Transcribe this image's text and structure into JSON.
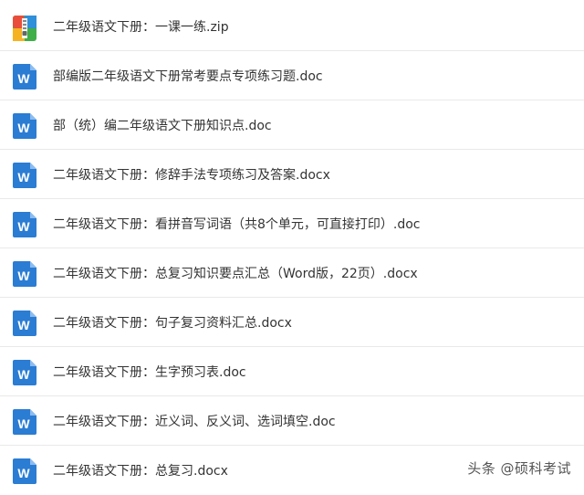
{
  "files": [
    {
      "name": "二年级语文下册：一课一练.zip",
      "icon": "zip-archive-icon"
    },
    {
      "name": "部编版二年级语文下册常考要点专项练习题.doc",
      "icon": "word-doc-icon"
    },
    {
      "name": "部（统）编二年级语文下册知识点.doc",
      "icon": "word-doc-icon"
    },
    {
      "name": "二年级语文下册：修辞手法专项练习及答案.docx",
      "icon": "word-doc-icon"
    },
    {
      "name": "二年级语文下册：看拼音写词语（共8个单元，可直接打印）.doc",
      "icon": "word-doc-icon"
    },
    {
      "name": "二年级语文下册：总复习知识要点汇总（Word版，22页）.docx",
      "icon": "word-doc-icon"
    },
    {
      "name": "二年级语文下册：句子复习资料汇总.docx",
      "icon": "word-doc-icon"
    },
    {
      "name": "二年级语文下册：生字预习表.doc",
      "icon": "word-doc-icon"
    },
    {
      "name": "二年级语文下册：近义词、反义词、选词填空.doc",
      "icon": "word-doc-icon"
    },
    {
      "name": "二年级语文下册：总复习.docx",
      "icon": "word-doc-icon"
    }
  ],
  "watermark": "头条 @硕科考试",
  "colors": {
    "word_blue": "#2b7cd3",
    "zip_red": "#e94e3c",
    "zip_green": "#3fae49",
    "zip_yellow": "#f5b324",
    "zip_blue": "#2f8fd8"
  }
}
